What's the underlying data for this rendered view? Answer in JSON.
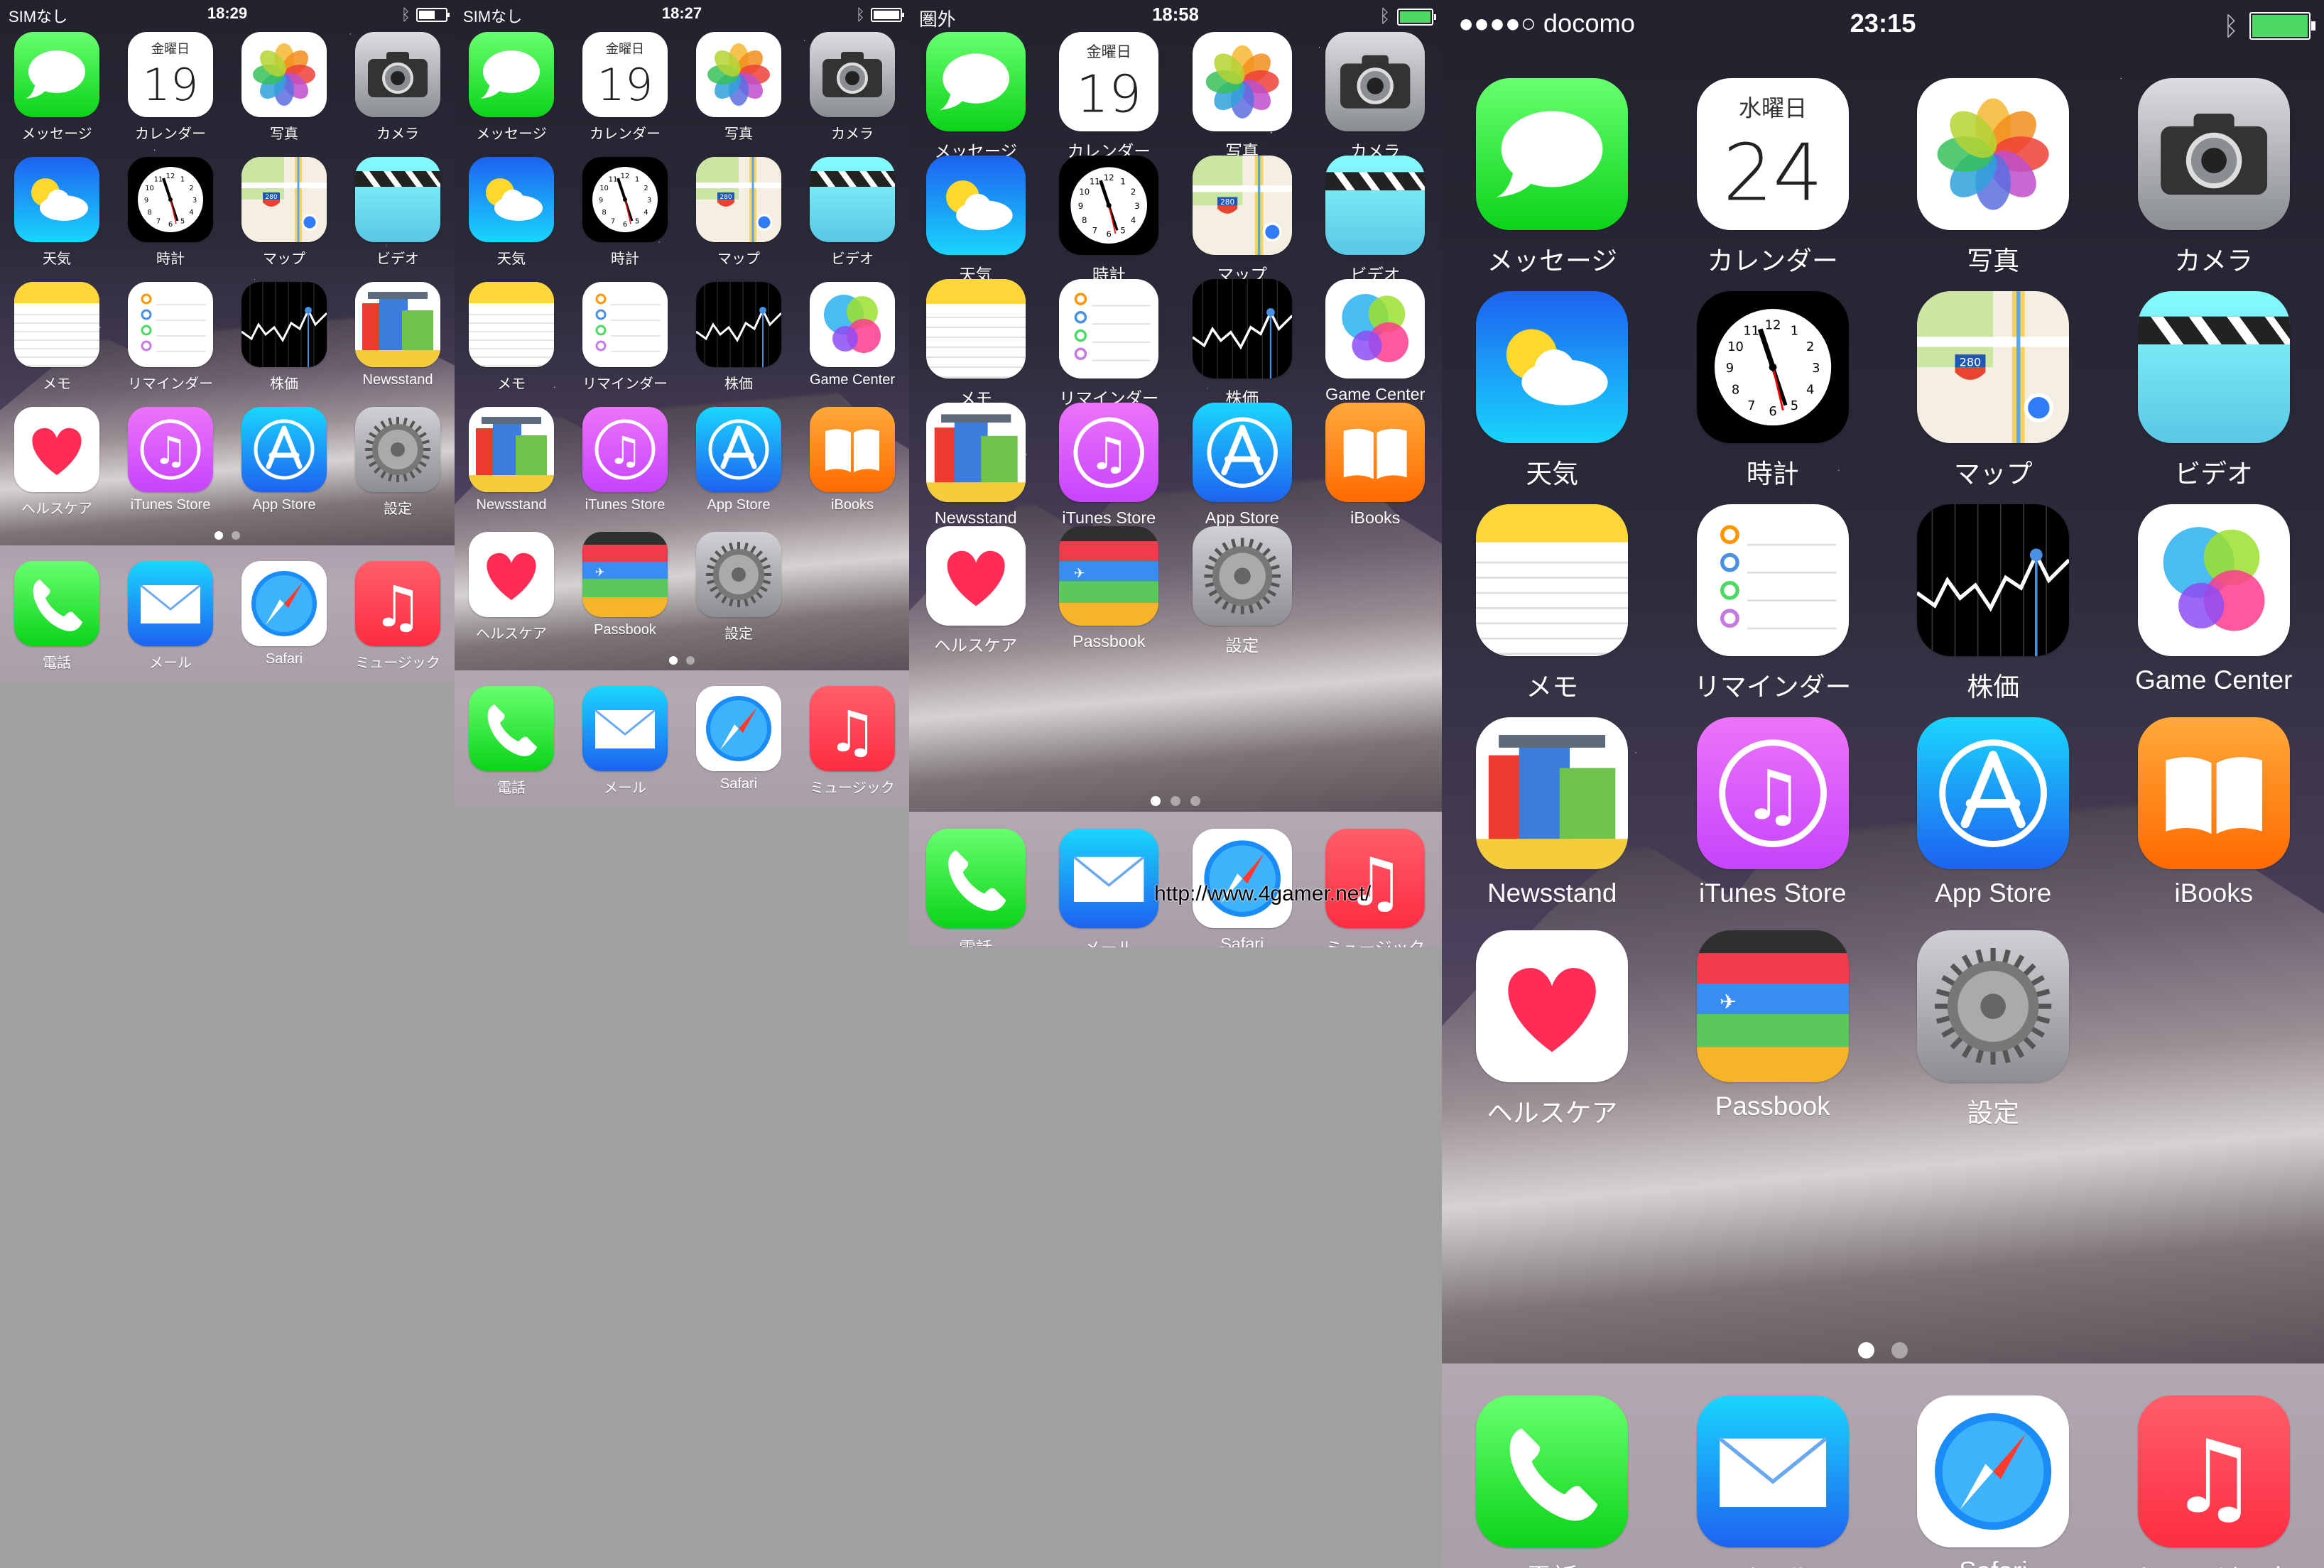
{
  "screens": [
    {
      "id": "screen1",
      "status": {
        "carrier": "SIMなし",
        "time": "18:29",
        "battery_percent": 60,
        "battery_color": "#ffffff"
      },
      "page_dots": {
        "count": 2,
        "active": 0
      },
      "apps": [
        {
          "label": "メッセージ",
          "icon": "messages-icon"
        },
        {
          "label": "カレンダー",
          "icon": "calendar-icon",
          "weekday": "金曜日",
          "day": "19"
        },
        {
          "label": "写真",
          "icon": "photos-icon"
        },
        {
          "label": "カメラ",
          "icon": "camera-icon"
        },
        {
          "label": "天気",
          "icon": "weather-icon"
        },
        {
          "label": "時計",
          "icon": "clock-icon"
        },
        {
          "label": "マップ",
          "icon": "maps-icon"
        },
        {
          "label": "ビデオ",
          "icon": "videos-icon"
        },
        {
          "label": "メモ",
          "icon": "notes-icon"
        },
        {
          "label": "リマインダー",
          "icon": "reminders-icon"
        },
        {
          "label": "株価",
          "icon": "stocks-icon"
        },
        {
          "label": "Newsstand",
          "icon": "newsstand-icon"
        },
        {
          "label": "ヘルスケア",
          "icon": "health-icon"
        },
        {
          "label": "iTunes Store",
          "icon": "itunes-icon"
        },
        {
          "label": "App Store",
          "icon": "appstore-icon"
        },
        {
          "label": "設定",
          "icon": "settings-icon"
        }
      ],
      "dock": [
        {
          "label": "電話",
          "icon": "phone-icon"
        },
        {
          "label": "メール",
          "icon": "mail-icon"
        },
        {
          "label": "Safari",
          "icon": "safari-icon"
        },
        {
          "label": "ミュージック",
          "icon": "music-icon"
        }
      ]
    },
    {
      "id": "screen2",
      "status": {
        "carrier": "SIMなし",
        "time": "18:27",
        "battery_percent": 100,
        "battery_color": "#ffffff"
      },
      "page_dots": {
        "count": 2,
        "active": 0
      },
      "apps": [
        {
          "label": "メッセージ",
          "icon": "messages-icon"
        },
        {
          "label": "カレンダー",
          "icon": "calendar-icon",
          "weekday": "金曜日",
          "day": "19"
        },
        {
          "label": "写真",
          "icon": "photos-icon"
        },
        {
          "label": "カメラ",
          "icon": "camera-icon"
        },
        {
          "label": "天気",
          "icon": "weather-icon"
        },
        {
          "label": "時計",
          "icon": "clock-icon"
        },
        {
          "label": "マップ",
          "icon": "maps-icon"
        },
        {
          "label": "ビデオ",
          "icon": "videos-icon"
        },
        {
          "label": "メモ",
          "icon": "notes-icon"
        },
        {
          "label": "リマインダー",
          "icon": "reminders-icon"
        },
        {
          "label": "株価",
          "icon": "stocks-icon"
        },
        {
          "label": "Game Center",
          "icon": "gamecenter-icon"
        },
        {
          "label": "Newsstand",
          "icon": "newsstand-icon"
        },
        {
          "label": "iTunes Store",
          "icon": "itunes-icon"
        },
        {
          "label": "App Store",
          "icon": "appstore-icon"
        },
        {
          "label": "iBooks",
          "icon": "ibooks-icon"
        },
        {
          "label": "ヘルスケア",
          "icon": "health-icon"
        },
        {
          "label": "Passbook",
          "icon": "passbook-icon"
        },
        {
          "label": "設定",
          "icon": "settings-icon"
        }
      ],
      "dock": [
        {
          "label": "電話",
          "icon": "phone-icon"
        },
        {
          "label": "メール",
          "icon": "mail-icon"
        },
        {
          "label": "Safari",
          "icon": "safari-icon"
        },
        {
          "label": "ミュージック",
          "icon": "music-icon"
        }
      ]
    },
    {
      "id": "screen3",
      "status": {
        "carrier": "圏外",
        "time": "18:58",
        "battery_percent": 100,
        "battery_color": "#4cd964"
      },
      "page_dots": {
        "count": 3,
        "active": 0
      },
      "apps": [
        {
          "label": "メッセージ",
          "icon": "messages-icon"
        },
        {
          "label": "カレンダー",
          "icon": "calendar-icon",
          "weekday": "金曜日",
          "day": "19"
        },
        {
          "label": "写真",
          "icon": "photos-icon"
        },
        {
          "label": "カメラ",
          "icon": "camera-icon"
        },
        {
          "label": "天気",
          "icon": "weather-icon"
        },
        {
          "label": "時計",
          "icon": "clock-icon"
        },
        {
          "label": "マップ",
          "icon": "maps-icon"
        },
        {
          "label": "ビデオ",
          "icon": "videos-icon"
        },
        {
          "label": "メモ",
          "icon": "notes-icon"
        },
        {
          "label": "リマインダー",
          "icon": "reminders-icon"
        },
        {
          "label": "株価",
          "icon": "stocks-icon"
        },
        {
          "label": "Game Center",
          "icon": "gamecenter-icon"
        },
        {
          "label": "Newsstand",
          "icon": "newsstand-icon"
        },
        {
          "label": "iTunes Store",
          "icon": "itunes-icon"
        },
        {
          "label": "App Store",
          "icon": "appstore-icon"
        },
        {
          "label": "iBooks",
          "icon": "ibooks-icon"
        },
        {
          "label": "ヘルスケア",
          "icon": "health-icon"
        },
        {
          "label": "Passbook",
          "icon": "passbook-icon"
        },
        {
          "label": "設定",
          "icon": "settings-icon"
        }
      ],
      "dock": [
        {
          "label": "電話",
          "icon": "phone-icon"
        },
        {
          "label": "メール",
          "icon": "mail-icon"
        },
        {
          "label": "Safari",
          "icon": "safari-icon"
        },
        {
          "label": "ミュージック",
          "icon": "music-icon"
        }
      ],
      "watermark": "http://www.4gamer.net/"
    },
    {
      "id": "screen4",
      "status": {
        "carrier": "●●●●○ docomo",
        "time": "23:15",
        "battery_percent": 100,
        "battery_color": "#4cd964"
      },
      "page_dots": {
        "count": 2,
        "active": 0
      },
      "apps": [
        {
          "label": "メッセージ",
          "icon": "messages-icon"
        },
        {
          "label": "カレンダー",
          "icon": "calendar-icon",
          "weekday": "水曜日",
          "day": "24"
        },
        {
          "label": "写真",
          "icon": "photos-icon"
        },
        {
          "label": "カメラ",
          "icon": "camera-icon"
        },
        {
          "label": "天気",
          "icon": "weather-icon"
        },
        {
          "label": "時計",
          "icon": "clock-icon"
        },
        {
          "label": "マップ",
          "icon": "maps-icon"
        },
        {
          "label": "ビデオ",
          "icon": "videos-icon"
        },
        {
          "label": "メモ",
          "icon": "notes-icon"
        },
        {
          "label": "リマインダー",
          "icon": "reminders-icon"
        },
        {
          "label": "株価",
          "icon": "stocks-icon"
        },
        {
          "label": "Game Center",
          "icon": "gamecenter-icon"
        },
        {
          "label": "Newsstand",
          "icon": "newsstand-icon"
        },
        {
          "label": "iTunes Store",
          "icon": "itunes-icon"
        },
        {
          "label": "App Store",
          "icon": "appstore-icon"
        },
        {
          "label": "iBooks",
          "icon": "ibooks-icon"
        },
        {
          "label": "ヘルスケア",
          "icon": "health-icon"
        },
        {
          "label": "Passbook",
          "icon": "passbook-icon"
        },
        {
          "label": "設定",
          "icon": "settings-icon"
        }
      ],
      "dock": [
        {
          "label": "電話",
          "icon": "phone-icon"
        },
        {
          "label": "メール",
          "icon": "mail-icon"
        },
        {
          "label": "Safari",
          "icon": "safari-icon"
        },
        {
          "label": "ミュージック",
          "icon": "music-icon"
        }
      ]
    }
  ]
}
